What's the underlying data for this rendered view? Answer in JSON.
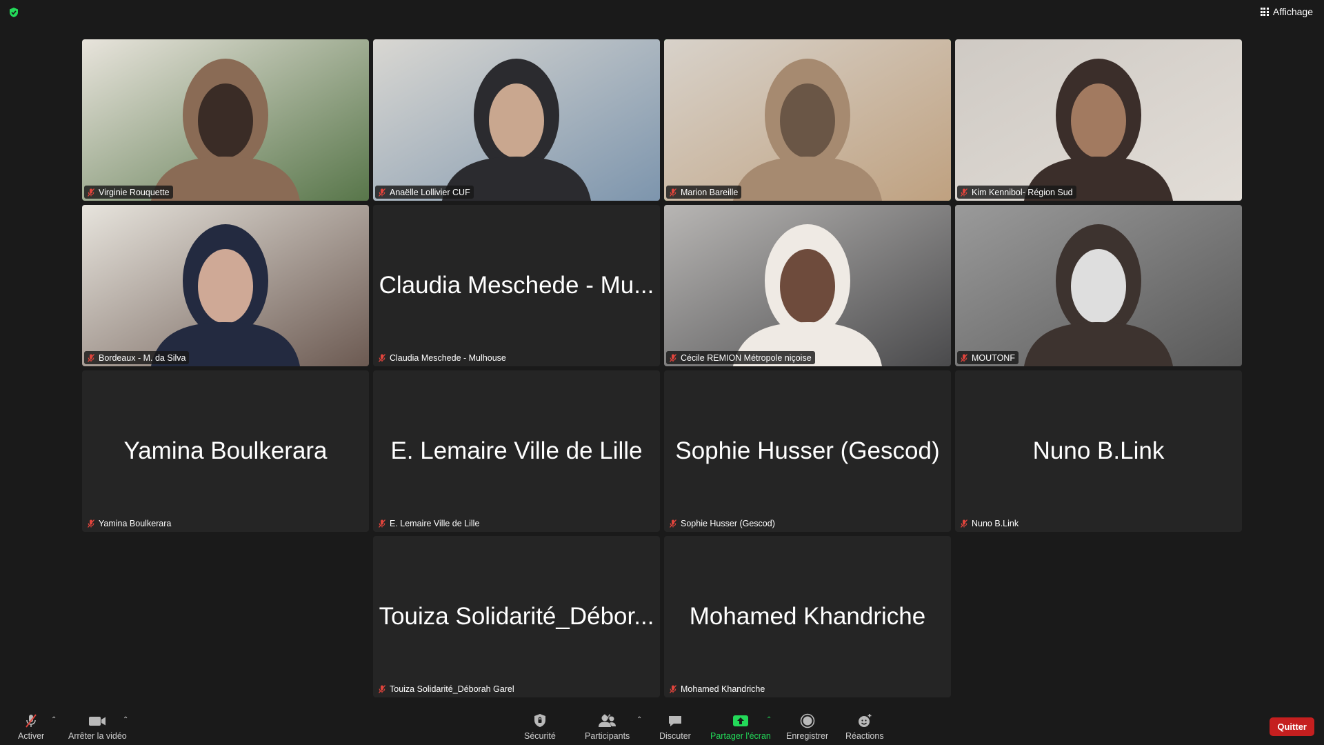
{
  "window": {
    "view_label": "Affichage"
  },
  "participants": [
    {
      "name": "Virginie Rouquette",
      "video": true,
      "palette": [
        "#e8e4dc",
        "#8a6b55",
        "#3a2c26",
        "#58764a"
      ]
    },
    {
      "name": "Anaëlle Lollivier CUF",
      "video": true,
      "palette": [
        "#d9d7d2",
        "#2b2b2f",
        "#c9a78f",
        "#7d95ad"
      ]
    },
    {
      "name": "Marion Bareille",
      "video": true,
      "active_speaker": true,
      "palette": [
        "#d8d2ca",
        "#a68a70",
        "#6a5646",
        "#bfa180"
      ]
    },
    {
      "name": "Kim Kennibol- Région Sud",
      "video": true,
      "palette": [
        "#cfcac4",
        "#3b2e2a",
        "#a27a60",
        "#e2ddd7"
      ]
    },
    {
      "name": "Bordeaux - M. da Silva",
      "video": true,
      "palette": [
        "#e7e4dd",
        "#232a40",
        "#cfa996",
        "#6c5a52"
      ]
    },
    {
      "name": "Claudia Meschede - Mulhouse",
      "display": "Claudia Meschede - Mu...",
      "video": false
    },
    {
      "name": "Cécile REMION Métropole niçoise",
      "video": true,
      "palette": [
        "#b8b6b4",
        "#efeae4",
        "#6e4b3c",
        "#4a4a4c"
      ]
    },
    {
      "name": "MOUTONF",
      "video": true,
      "palette": [
        "#9a9a9a",
        "#3d332f",
        "#dedede",
        "#595959"
      ]
    },
    {
      "name": "Yamina Boulkerara",
      "display": "Yamina Boulkerara",
      "video": false
    },
    {
      "name": "E. Lemaire Ville de Lille",
      "display": "E. Lemaire Ville de Lille",
      "video": false
    },
    {
      "name": "Sophie Husser (Gescod)",
      "display": "Sophie Husser (Gescod)",
      "video": false
    },
    {
      "name": "Nuno B.Link",
      "display": "Nuno B.Link",
      "video": false
    },
    {
      "name": "Touiza Solidarité_Déborah Garel",
      "display": "Touiza Solidarité_Débor...",
      "video": false
    },
    {
      "name": "Mohamed Khandriche",
      "display": "Mohamed Khandriche",
      "video": false
    }
  ],
  "toolbar": {
    "mute_label": "Activer",
    "video_label": "Arrêter la vidéo",
    "security_label": "Sécurité",
    "participants_label": "Participants",
    "participants_count": "14",
    "chat_label": "Discuter",
    "share_label": "Partager l'écran",
    "record_label": "Enregistrer",
    "reactions_label": "Réactions",
    "quit_label": "Quitter"
  },
  "colors": {
    "share_accent": "#23d959",
    "quit": "#c51f1f",
    "mute_icon": "#e0443c"
  }
}
